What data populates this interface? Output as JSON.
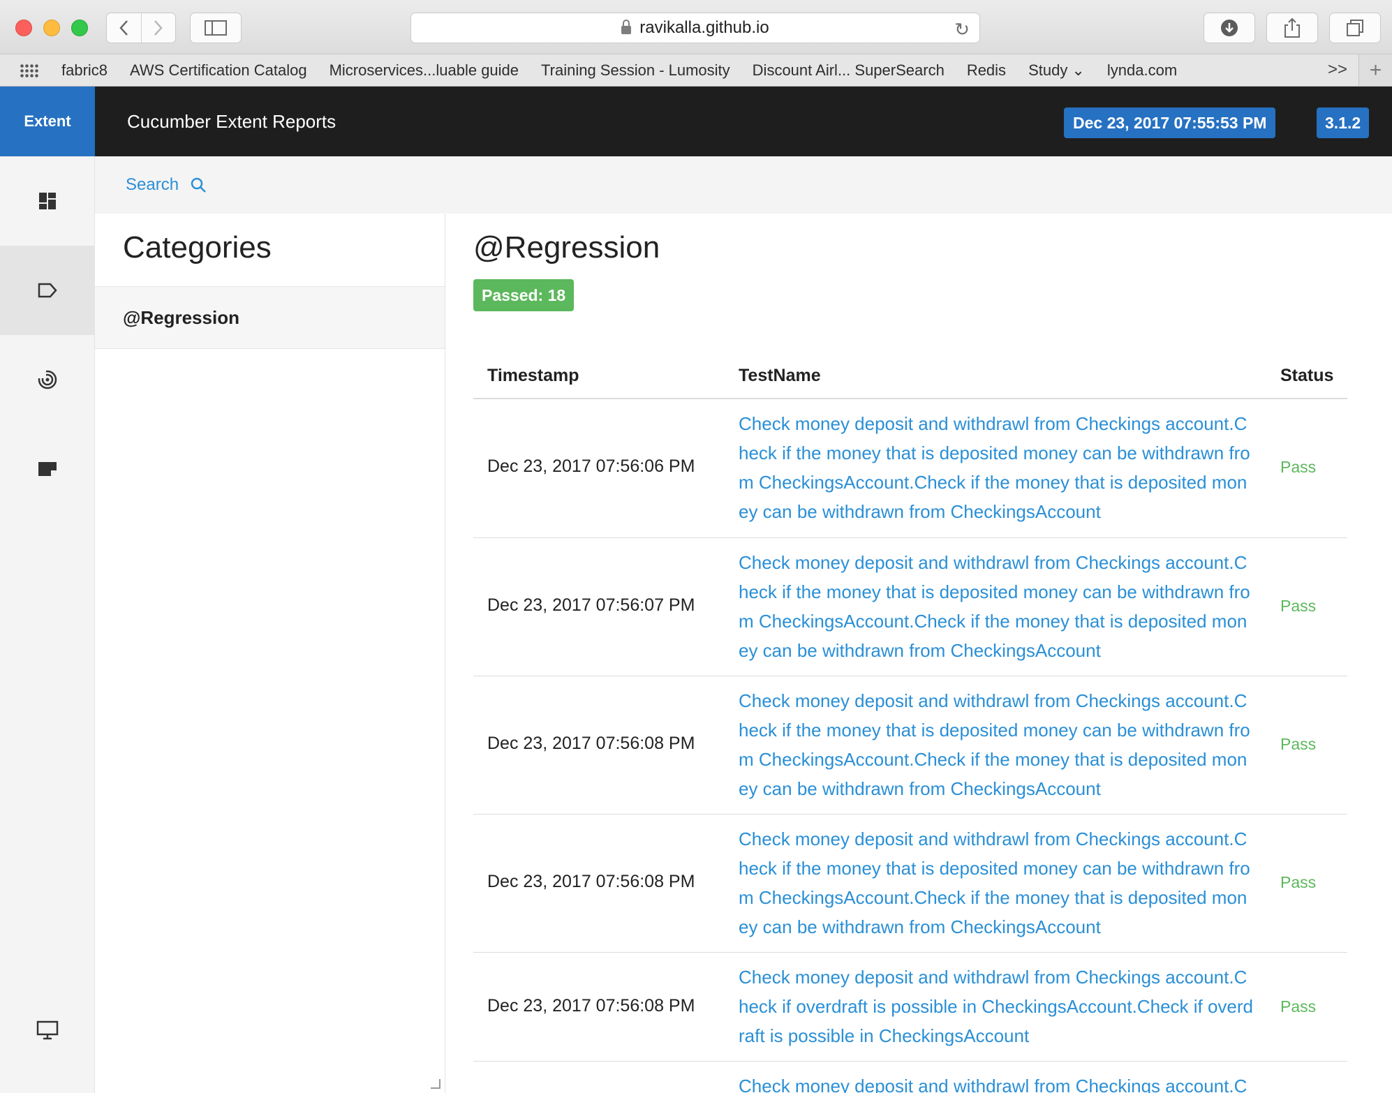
{
  "browser": {
    "url": "ravikalla.github.io",
    "bookmarks": [
      "fabric8",
      "AWS Certification Catalog",
      "Microservices...luable guide",
      "Training Session - Lumosity",
      "Discount Airl... SuperSearch",
      "Redis",
      "Study ⌄",
      "lynda.com"
    ],
    "more": ">>",
    "plus": "+"
  },
  "header": {
    "brand": "Extent",
    "report_name": "Cucumber Extent Reports",
    "date": "Dec 23, 2017 07:55:53 PM",
    "version": "3.1.2"
  },
  "leftnav": {
    "icons": [
      "dashboard-icon",
      "tag-icon",
      "exception-icon",
      "log-icon",
      "monitor-icon"
    ],
    "active": "tag-icon"
  },
  "search": {
    "label": "Search"
  },
  "categories": {
    "title": "Categories",
    "items": [
      "@Regression"
    ]
  },
  "detail": {
    "title": "@Regression",
    "passed_label": "Passed: 18",
    "columns": {
      "timestamp": "Timestamp",
      "testname": "TestName",
      "status": "Status"
    },
    "rows": [
      {
        "timestamp": "Dec 23, 2017 07:56:06 PM",
        "name": "Check money deposit and withdrawl from Checkings account.Check if the money that is deposited money can be withdrawn from CheckingsAccount.Check if the money that is deposited money can be withdrawn from CheckingsAccount",
        "status": "Pass"
      },
      {
        "timestamp": "Dec 23, 2017 07:56:07 PM",
        "name": "Check money deposit and withdrawl from Checkings account.Check if the money that is deposited money can be withdrawn from CheckingsAccount.Check if the money that is deposited money can be withdrawn from CheckingsAccount",
        "status": "Pass"
      },
      {
        "timestamp": "Dec 23, 2017 07:56:08 PM",
        "name": "Check money deposit and withdrawl from Checkings account.Check if the money that is deposited money can be withdrawn from CheckingsAccount.Check if the money that is deposited money can be withdrawn from CheckingsAccount",
        "status": "Pass"
      },
      {
        "timestamp": "Dec 23, 2017 07:56:08 PM",
        "name": "Check money deposit and withdrawl from Checkings account.Check if the money that is deposited money can be withdrawn from CheckingsAccount.Check if the money that is deposited money can be withdrawn from CheckingsAccount",
        "status": "Pass"
      },
      {
        "timestamp": "Dec 23, 2017 07:56:08 PM",
        "name": "Check money deposit and withdrawl from Checkings account.Check if overdraft is possible in CheckingsAccount.Check if overdraft is possible in CheckingsAccount",
        "status": "Pass"
      },
      {
        "timestamp": "",
        "name": "Check money deposit and withdrawl from Checkings account.C",
        "status": ""
      }
    ]
  },
  "colors": {
    "accent": "#2671c1",
    "header_bg": "#1e1e1e",
    "link": "#2a8fd6",
    "pass": "#5cb85c"
  }
}
